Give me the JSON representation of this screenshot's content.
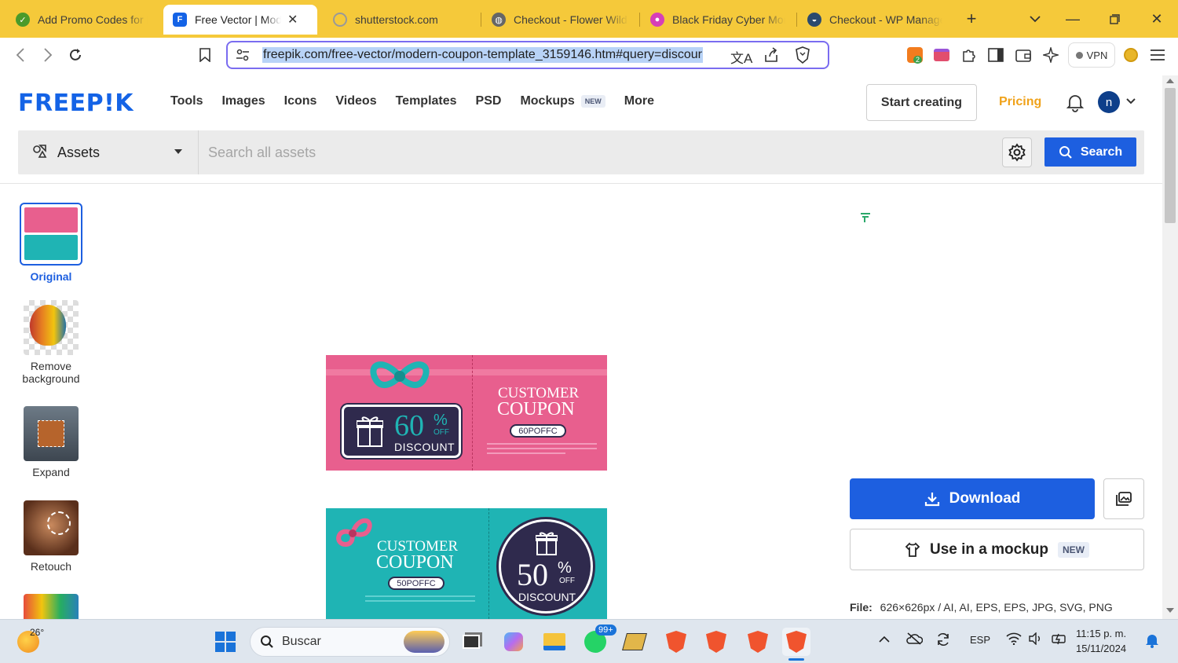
{
  "browser": {
    "tabs": [
      {
        "title": "Add Promo Codes for F",
        "favicon_color": "#4a9a2a"
      },
      {
        "title": "Free Vector | Mode",
        "favicon_color": "#1463e6",
        "active": true
      },
      {
        "title": "shutterstock.com",
        "favicon_color": "#999999"
      },
      {
        "title": "Checkout - Flower Wild",
        "favicon_color": "#555555"
      },
      {
        "title": "Black Friday Cyber Mor",
        "favicon_color": "#d63fb8"
      },
      {
        "title": "Checkout - WP Manage",
        "favicon_color": "#2b4a6e"
      }
    ],
    "url": "freepik.com/free-vector/modern-coupon-template_3159146.htm#query=discour",
    "vpn_label": "VPN",
    "extension_badge": "2"
  },
  "header": {
    "logo": "FREEP!K",
    "nav": [
      {
        "label": "Tools"
      },
      {
        "label": "Images"
      },
      {
        "label": "Icons"
      },
      {
        "label": "Videos"
      },
      {
        "label": "Templates"
      },
      {
        "label": "PSD"
      },
      {
        "label": "Mockups",
        "badge": "NEW"
      },
      {
        "label": "More"
      }
    ],
    "start_creating": "Start creating",
    "pricing": "Pricing",
    "avatar_initial": "n"
  },
  "search": {
    "category": "Assets",
    "placeholder": "Search all assets",
    "button": "Search"
  },
  "tools": [
    {
      "label": "Original"
    },
    {
      "label": "Remove background"
    },
    {
      "label": "Expand"
    },
    {
      "label": "Retouch"
    }
  ],
  "preview": {
    "coupon1": {
      "title_line1": "CUSTOMER",
      "title_line2": "COUPON",
      "code": "60POFFC",
      "percent": "60",
      "off": "OFF",
      "discount": "DISCOUNT"
    },
    "coupon2": {
      "title_line1": "CUSTOMER",
      "title_line2": "COUPON",
      "code": "50POFFC",
      "percent": "50",
      "off": "OFF",
      "discount": "DISCOUNT"
    }
  },
  "panel": {
    "download": "Download",
    "mockup": "Use in a mockup",
    "mockup_badge": "NEW",
    "file_label": "File:",
    "file_value": "626×626px / AI, AI, EPS, EPS, JPG, SVG, PNG"
  },
  "taskbar": {
    "weather_temp": "26°",
    "search_placeholder": "Buscar",
    "whatsapp_badge": "99+",
    "language": "ESP",
    "time": "11:15 p. m.",
    "date": "15/11/2024"
  },
  "colors": {
    "brand_blue": "#1d5fe0",
    "tab_strip": "#f5c93a",
    "pricing": "#f0a21a",
    "coupon_pink": "#e85f8e",
    "coupon_teal": "#1fb4b4"
  }
}
